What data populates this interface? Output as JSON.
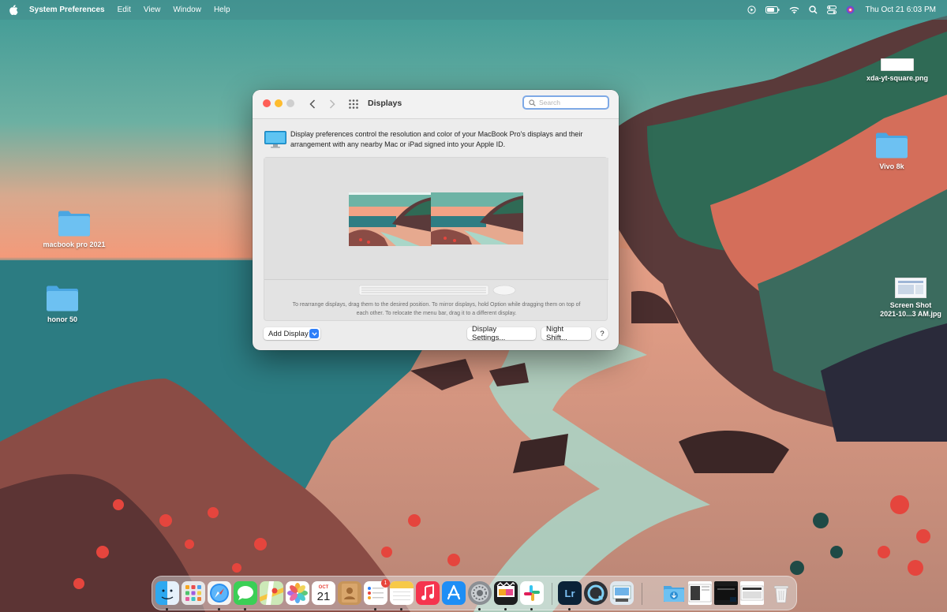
{
  "menubar": {
    "apple_icon": "apple-logo-icon",
    "app_name": "System Preferences",
    "menus": [
      "Edit",
      "View",
      "Window",
      "Help"
    ],
    "status_icons": [
      "play-icon",
      "battery-icon",
      "wifi-icon",
      "search-icon",
      "control-center-icon",
      "siri-icon"
    ],
    "clock": "Thu Oct 21  6:03 PM"
  },
  "desktop": {
    "items": [
      {
        "label": "xda-yt-square.png",
        "kind": "image-file"
      },
      {
        "label": "Vivo 8k",
        "kind": "folder"
      },
      {
        "label": "macbook pro 2021",
        "kind": "folder"
      },
      {
        "label": "honor  50",
        "kind": "folder"
      },
      {
        "label_line1": "Screen Shot",
        "label_line2": "2021-10...3 AM.jpg",
        "kind": "image-file"
      }
    ]
  },
  "window": {
    "title": "Displays",
    "search_placeholder": "Search",
    "intro": "Display preferences control the resolution and color of your MacBook Pro's displays and their arrangement with any nearby Mac or iPad signed into your Apple ID.",
    "hint": "To rearrange displays, drag them to the desired position. To mirror displays, hold Option while dragging them on top of each other. To relocate the menu bar, drag it to a different display.",
    "buttons": {
      "add_display": "Add Display",
      "display_settings": "Display Settings...",
      "night_shift": "Night Shift...",
      "help": "?"
    },
    "displays": [
      "display-1",
      "display-2"
    ]
  },
  "dock": {
    "apps": [
      {
        "name": "Finder",
        "icon": "finder-icon",
        "running": true
      },
      {
        "name": "Launchpad",
        "icon": "launchpad-icon",
        "running": false
      },
      {
        "name": "Safari",
        "icon": "safari-icon",
        "running": true
      },
      {
        "name": "Messages",
        "icon": "messages-icon",
        "running": true
      },
      {
        "name": "Maps",
        "icon": "maps-icon",
        "running": false
      },
      {
        "name": "Photos",
        "icon": "photos-icon",
        "running": false
      },
      {
        "name": "Calendar",
        "icon": "calendar-icon",
        "month": "OCT",
        "day": "21",
        "running": false
      },
      {
        "name": "Contacts",
        "icon": "contacts-icon",
        "running": false
      },
      {
        "name": "Reminders",
        "icon": "reminders-icon",
        "badge": "1",
        "running": true
      },
      {
        "name": "Notes",
        "icon": "notes-icon",
        "running": true
      },
      {
        "name": "Music",
        "icon": "music-icon",
        "running": false
      },
      {
        "name": "App Store",
        "icon": "app-store-icon",
        "running": false
      },
      {
        "name": "System Preferences",
        "icon": "system-preferences-icon",
        "running": true
      },
      {
        "name": "Final Cut Pro",
        "icon": "final-cut-icon",
        "running": true
      },
      {
        "name": "Slack",
        "icon": "slack-icon",
        "running": true
      },
      {
        "name": "Lightroom",
        "label": "Lr",
        "icon": "lightroom-icon",
        "running": true
      },
      {
        "name": "QuickTime",
        "icon": "quicktime-icon",
        "running": false
      },
      {
        "name": "Preview",
        "icon": "preview-icon",
        "running": false
      },
      {
        "name": "Downloads",
        "icon": "downloads-folder-icon"
      },
      {
        "name": "Recent Doc 1",
        "icon": "document-thumbnail-icon"
      },
      {
        "name": "Recent Doc 2",
        "icon": "document-thumbnail-icon"
      },
      {
        "name": "Recent Doc 3",
        "icon": "document-thumbnail-icon"
      },
      {
        "name": "Trash",
        "icon": "trash-icon"
      }
    ]
  },
  "colors": {
    "sea": "#2f6f76",
    "sky_top": "#4fa69f",
    "sunset": "#f29a7c",
    "accent_blue": "#2d7ff9",
    "folder_blue": "#5ab6ee"
  }
}
